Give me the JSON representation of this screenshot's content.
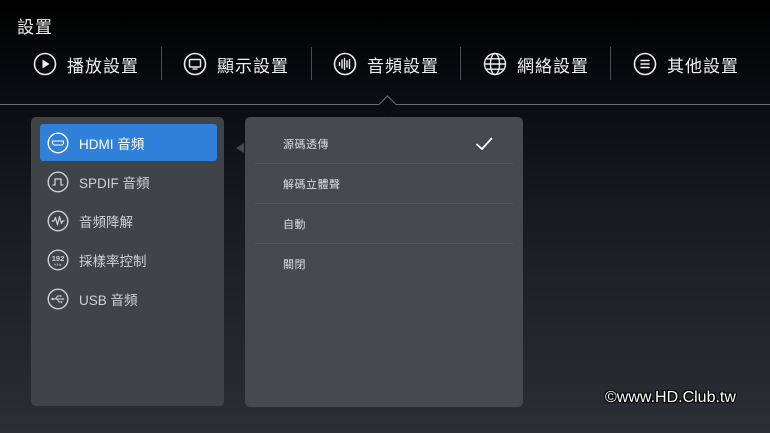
{
  "window": {
    "title": "設置"
  },
  "tabs": [
    {
      "label": "播放設置",
      "icon": "play-icon"
    },
    {
      "label": "顯示設置",
      "icon": "display-icon"
    },
    {
      "label": "音頻設置",
      "icon": "audio-wave-icon",
      "active": true
    },
    {
      "label": "網絡設置",
      "icon": "globe-icon"
    },
    {
      "label": "其他設置",
      "icon": "menu-list-icon"
    }
  ],
  "audio_menu": {
    "selected_index": 0,
    "items": [
      {
        "label": "HDMI 音頻",
        "icon": "hdmi-icon"
      },
      {
        "label": "SPDIF 音頻",
        "icon": "spdif-icon"
      },
      {
        "label": "音頻降解",
        "icon": "audio-downmix-icon"
      },
      {
        "label": "採樣率控制",
        "icon": "sample-rate-192-icon",
        "icon_text": "192",
        "icon_subtext": "KHz"
      },
      {
        "label": "USB 音頻",
        "icon": "usb-icon"
      }
    ]
  },
  "hdmi_options": {
    "checked_index": 0,
    "items": [
      {
        "label": "源碼透傳"
      },
      {
        "label": "解碼立體聲"
      },
      {
        "label": "自動"
      },
      {
        "label": "關閉"
      }
    ]
  },
  "watermark": {
    "text": "©www.HD.Club.tw"
  },
  "colors": {
    "accent": "#2f80d8",
    "panel": "#404347",
    "options_panel": "#46494d"
  }
}
